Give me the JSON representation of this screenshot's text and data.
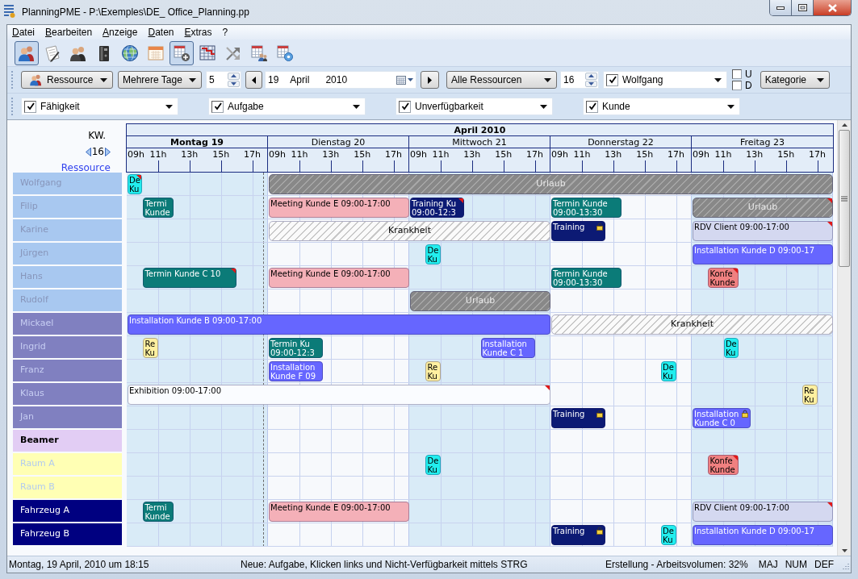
{
  "window": {
    "title": "PlanningPME - P:\\Exemples\\DE_ Office_Planning.pp"
  },
  "menu": [
    "Datei",
    "Bearbeiten",
    "Anzeige",
    "Daten",
    "Extras",
    "?"
  ],
  "toolbar": [
    {
      "kind": "users",
      "selected": true
    },
    {
      "kind": "notepad",
      "selected": false
    },
    {
      "kind": "team",
      "selected": false
    },
    {
      "kind": "binder",
      "selected": false
    },
    {
      "kind": "globe",
      "selected": false
    },
    {
      "kind": "calendar",
      "selected": false
    },
    {
      "kind": "planner",
      "selected": true
    },
    {
      "kind": "chart",
      "selected": false
    },
    {
      "kind": "link",
      "selected": false
    },
    {
      "kind": "assign",
      "selected": false
    },
    {
      "kind": "sync",
      "selected": false
    }
  ],
  "navigation": {
    "view_button": "Ressource",
    "period": "Mehrere Tage",
    "day_count": "5",
    "date": {
      "day": "19",
      "month": "April",
      "year": "2010"
    },
    "resource_filter": "Alle Ressourcen",
    "row_count": "16",
    "resource": {
      "label": "Wolfgang",
      "checked": true
    },
    "options": [
      {
        "label": "U",
        "checked": false
      },
      {
        "label": "D",
        "checked": false
      }
    ],
    "category": "Kategorie"
  },
  "filters": [
    {
      "label": "Fähigkeit",
      "checked": true
    },
    {
      "label": "Aufgabe",
      "checked": true
    },
    {
      "label": "Unverfügbarkeit",
      "checked": true
    },
    {
      "label": "Kunde",
      "checked": true
    }
  ],
  "planner": {
    "week_label": "KW.",
    "week": "16",
    "resource_link": "Ressource",
    "month": "April 2010",
    "days": [
      {
        "label": "Montag 19",
        "today": true,
        "shaded": true,
        "hours": [
          "09h",
          "11h",
          "13h",
          "15h",
          "17h"
        ]
      },
      {
        "label": "Dienstag 20",
        "today": false,
        "shaded": false,
        "hours": [
          "09h",
          "11h",
          "13h",
          "15h",
          "17h"
        ]
      },
      {
        "label": "Mittwoch 21",
        "today": false,
        "shaded": true,
        "hours": [
          "09h",
          "11h",
          "13h",
          "15h",
          "17h"
        ]
      },
      {
        "label": "Donnerstag 22",
        "today": false,
        "shaded": false,
        "hours": [
          "09h",
          "11h",
          "13h",
          "15h",
          "17h"
        ]
      },
      {
        "label": "Freitag 23",
        "today": false,
        "shaded": true,
        "hours": [
          "09h",
          "11h",
          "13h",
          "15h",
          "17h"
        ]
      }
    ],
    "resources": [
      {
        "name": "Wolfgang",
        "kind": "muted",
        "color": "#a8c8f0",
        "events": [
          {
            "text": "De Ku",
            "color": "#22eeee",
            "kind": "solid",
            "flagged": true,
            "locked": false
          },
          {
            "text": "Urlaub",
            "color": "#888888",
            "kind": "hatched",
            "flagged": false,
            "locked": false
          }
        ]
      },
      {
        "name": "Filip",
        "kind": "muted",
        "color": "#a8c8f0",
        "events": [
          {
            "text": "Termi Kunde",
            "color": "#0b7b78",
            "kind": "solid",
            "flagged": false,
            "locked": false
          },
          {
            "text": "Meeting Kunde E 09:00-17:00",
            "color": "#f4b0b8",
            "kind": "solid",
            "flagged": false,
            "locked": false
          },
          {
            "text": "Training Ku 09:00-12:3",
            "color": "#0c1a74",
            "kind": "solid",
            "flagged": true,
            "locked": false
          },
          {
            "text": "Termin Kunde 09:00-13:30",
            "color": "#0b7b78",
            "kind": "solid",
            "flagged": false,
            "locked": false
          },
          {
            "text": "Urlaub",
            "color": "#888888",
            "kind": "hatched",
            "flagged": true,
            "locked": false
          }
        ]
      },
      {
        "name": "Karine",
        "kind": "muted",
        "color": "#a8c8f0",
        "events": [
          {
            "text": "Krankheit",
            "color": "#fafafa",
            "kind": "hatched",
            "flagged": false,
            "locked": false
          },
          {
            "text": "Training",
            "color": "#0c1a74",
            "kind": "solid",
            "flagged": false,
            "locked": true
          },
          {
            "text": "RDV Client 09:00-17:00",
            "color": "#d4d8f0",
            "kind": "solid",
            "flagged": true,
            "locked": false
          }
        ]
      },
      {
        "name": "Jürgen",
        "kind": "muted",
        "color": "#a8c8f0",
        "events": [
          {
            "text": "De Ku",
            "color": "#22eeee",
            "kind": "solid",
            "flagged": false,
            "locked": false
          },
          {
            "text": "Installation Kunde D 09:00-17",
            "color": "#6666ff",
            "kind": "solid",
            "flagged": false,
            "locked": false
          }
        ]
      },
      {
        "name": "Hans",
        "kind": "muted",
        "color": "#a8c8f0",
        "events": [
          {
            "text": "Termin Kunde C 10",
            "color": "#0b7b78",
            "kind": "solid",
            "flagged": true,
            "locked": false
          },
          {
            "text": "Meeting Kunde E 09:00-17:00",
            "color": "#f4b0b8",
            "kind": "solid",
            "flagged": false,
            "locked": false
          },
          {
            "text": "Termin Kunde 09:00-13:30",
            "color": "#0b7b78",
            "kind": "solid",
            "flagged": false,
            "locked": false
          },
          {
            "text": "Konfe Kunde",
            "color": "#f08080",
            "kind": "solid",
            "flagged": true,
            "locked": false
          }
        ]
      },
      {
        "name": "Rudolf",
        "kind": "muted",
        "color": "#a8c8f0",
        "events": [
          {
            "text": "Urlaub",
            "color": "#888888",
            "kind": "hatched",
            "flagged": false,
            "locked": false
          }
        ]
      },
      {
        "name": "Mickael",
        "kind": "dim",
        "color": "#8080c0",
        "events": [
          {
            "text": "Installation Kunde B 09:00-17:00",
            "color": "#6666ff",
            "kind": "solid",
            "flagged": false,
            "locked": false
          },
          {
            "text": "Krankheit",
            "color": "#fafafa",
            "kind": "hatched",
            "flagged": false,
            "locked": false
          }
        ]
      },
      {
        "name": "Ingrid",
        "kind": "dim",
        "color": "#8080c0",
        "events": [
          {
            "text": "Re Ku",
            "color": "#fff0a0",
            "kind": "solid",
            "flagged": false,
            "locked": false
          },
          {
            "text": "Termin Ku 09:00-12:3",
            "color": "#0b7b78",
            "kind": "solid",
            "flagged": false,
            "locked": false
          },
          {
            "text": "Installation Kunde C 1",
            "color": "#6666ff",
            "kind": "solid",
            "flagged": false,
            "locked": false
          },
          {
            "text": "De Ku",
            "color": "#22eeee",
            "kind": "solid",
            "flagged": false,
            "locked": false
          }
        ]
      },
      {
        "name": "Franz",
        "kind": "dim",
        "color": "#8080c0",
        "events": [
          {
            "text": "Installation Kunde F 09",
            "color": "#6666ff",
            "kind": "solid",
            "flagged": false,
            "locked": false
          },
          {
            "text": "Re Ku",
            "color": "#fff0a0",
            "kind": "solid",
            "flagged": false,
            "locked": false
          },
          {
            "text": "De Ku",
            "color": "#22eeee",
            "kind": "solid",
            "flagged": false,
            "locked": false
          }
        ]
      },
      {
        "name": "Klaus",
        "kind": "dim",
        "color": "#8080c0",
        "events": [
          {
            "text": "Exhibition 09:00-17:00",
            "color": "#fafcff",
            "kind": "solid",
            "flagged": true,
            "locked": false
          },
          {
            "text": "Re Ku",
            "color": "#fff0a0",
            "kind": "solid",
            "flagged": false,
            "locked": false
          }
        ]
      },
      {
        "name": "Jan",
        "kind": "dim",
        "color": "#8080c0",
        "events": [
          {
            "text": "Training",
            "color": "#0c1a74",
            "kind": "solid",
            "flagged": false,
            "locked": true
          },
          {
            "text": "Installation Kunde C 0",
            "color": "#6666ff",
            "kind": "solid",
            "flagged": false,
            "locked": true
          }
        ]
      },
      {
        "name": "Beamer",
        "kind": "bold",
        "color": "#e2cdf4"
      },
      {
        "name": "Raum A",
        "kind": "faint",
        "color": "#ffffb4",
        "events": [
          {
            "text": "De Ku",
            "color": "#22eeee",
            "kind": "solid",
            "flagged": false,
            "locked": false
          },
          {
            "text": "Konfe Kunde",
            "color": "#f08080",
            "kind": "solid",
            "flagged": true,
            "locked": false
          }
        ]
      },
      {
        "name": "Raum B",
        "kind": "faint",
        "color": "#ffffb4"
      },
      {
        "name": "Fahrzeug A",
        "kind": "bright",
        "color": "#000080",
        "events": [
          {
            "text": "Termi Kunde",
            "color": "#0b7b78",
            "kind": "solid",
            "flagged": false,
            "locked": false
          },
          {
            "text": "Meeting Kunde E 09:00-17:00",
            "color": "#f4b0b8",
            "kind": "solid",
            "flagged": false,
            "locked": false
          },
          {
            "text": "RDV Client 09:00-17:00",
            "color": "#d4d8f0",
            "kind": "solid",
            "flagged": true,
            "locked": false
          }
        ]
      },
      {
        "name": "Fahrzeug B",
        "kind": "bright",
        "color": "#000080",
        "events": [
          {
            "text": "Training",
            "color": "#0c1a74",
            "kind": "solid",
            "flagged": false,
            "locked": true
          },
          {
            "text": "De Ku",
            "color": "#22eeee",
            "kind": "solid",
            "flagged": false,
            "locked": false
          },
          {
            "text": "Installation Kunde D 09:00-17",
            "color": "#6666ff",
            "kind": "solid",
            "flagged": false,
            "locked": false
          }
        ]
      }
    ]
  },
  "status_bar": [
    "Montag, 19 April, 2010 um 18:15",
    "Neue: Aufgabe, Klicken links und Nicht-Verfügbarkeit mittels STRG",
    "Erstellung - Arbeitsvolumen: 32%",
    "MAJ",
    "NUM",
    "DEF"
  ]
}
